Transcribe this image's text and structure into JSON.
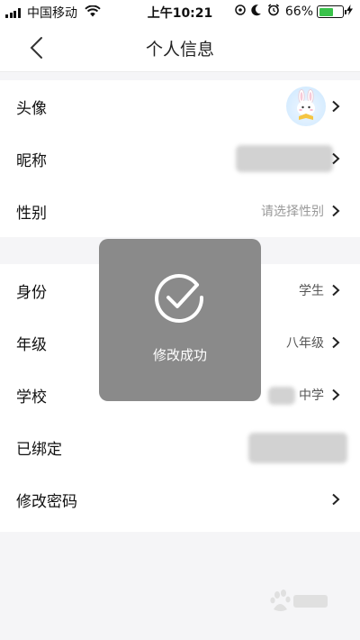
{
  "status_bar": {
    "carrier": "中国移动",
    "time": "上午10:21",
    "battery_percent": "66%",
    "battery_level": 0.66,
    "icons": [
      "signal-icon",
      "wifi-icon",
      "location-icon",
      "moon-icon",
      "alarm-icon",
      "battery-icon",
      "charging-icon"
    ]
  },
  "nav": {
    "title": "个人信息",
    "back_icon": "chevron-left-icon"
  },
  "group1": {
    "items": [
      {
        "label": "头像",
        "value": ""
      },
      {
        "label": "昵称",
        "value": ""
      },
      {
        "label": "性别",
        "value": "请选择性别"
      }
    ]
  },
  "group2": {
    "items": [
      {
        "label": "身份",
        "value": "学生"
      },
      {
        "label": "年级",
        "value": "八年级"
      },
      {
        "label": "学校",
        "value": "中学"
      },
      {
        "label": "已绑定",
        "value": ""
      },
      {
        "label": "修改密码",
        "value": ""
      }
    ]
  },
  "toast": {
    "message": "修改成功",
    "icon": "check-circle-icon"
  },
  "colors": {
    "battery": "#39c24a",
    "toast_bg": "#808080",
    "background": "#f5f5f7"
  }
}
